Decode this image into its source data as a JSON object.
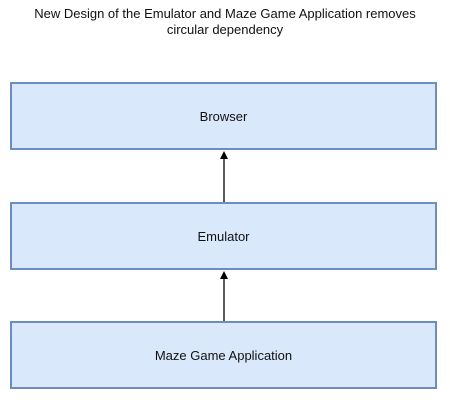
{
  "diagram": {
    "title_line1": "New Design of the Emulator and Maze Game Application removes",
    "title_line2": "circular dependency",
    "nodes": {
      "browser": "Browser",
      "emulator": "Emulator",
      "maze": "Maze Game Application"
    },
    "edges": [
      {
        "from": "emulator",
        "to": "browser"
      },
      {
        "from": "maze",
        "to": "emulator"
      }
    ],
    "colors": {
      "node_fill": "#dae8fc",
      "node_stroke": "#6c8ebf",
      "arrow": "#000000"
    }
  }
}
